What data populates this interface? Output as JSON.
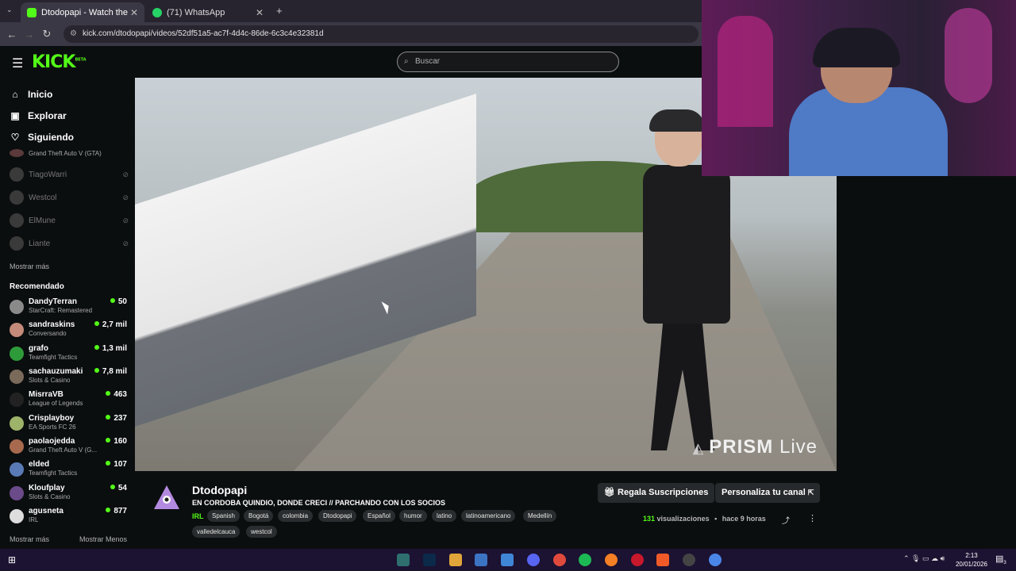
{
  "browser": {
    "tabs": [
      {
        "title": "Dtodopapi - Watch the VO",
        "active": true
      },
      {
        "title": "(71) WhatsApp",
        "active": false
      }
    ],
    "new_tab": "+",
    "url": "kick.com/dtodopapi/videos/52df51a5-ac7f-4d4c-86de-6c3c4e32381d"
  },
  "header": {
    "logo": "KICK",
    "logo_badge": "BETA",
    "search_placeholder": "Buscar"
  },
  "sidebar": {
    "nav": [
      {
        "label": "Inicio",
        "icon": "home-icon"
      },
      {
        "label": "Explorar",
        "icon": "compass-icon"
      },
      {
        "label": "Siguiendo",
        "icon": "heart-icon"
      }
    ],
    "following_partial_game": "Grand Theft Auto V (GTA)",
    "following": [
      "TiagoWarri",
      "Westcol",
      "ElMune",
      "Liante"
    ],
    "show_more": "Mostrar más",
    "recommended_title": "Recomendado",
    "recommended": [
      {
        "name": "DandyTerran",
        "game": "StarCraft: Remastered",
        "viewers": "50"
      },
      {
        "name": "sandraskins",
        "game": "Conversando",
        "viewers": "2,7 mil"
      },
      {
        "name": "grafo",
        "game": "Teamfight Tactics",
        "viewers": "1,3 mil"
      },
      {
        "name": "sachauzumaki",
        "game": "Slots & Casino",
        "viewers": "7,8 mil"
      },
      {
        "name": "MisrraVB",
        "game": "League of Legends",
        "viewers": "463"
      },
      {
        "name": "Crisplayboy",
        "game": "EA Sports FC 26",
        "viewers": "237"
      },
      {
        "name": "paolaojedda",
        "game": "Grand Theft Auto V (G...",
        "viewers": "160"
      },
      {
        "name": "elded",
        "game": "Teamfight Tactics",
        "viewers": "107"
      },
      {
        "name": "Kloufplay",
        "game": "Slots & Casino",
        "viewers": "54"
      },
      {
        "name": "agusneta",
        "game": "IRL",
        "viewers": "877"
      }
    ],
    "show_more_2": "Mostrar más",
    "show_less": "Mostrar Menos"
  },
  "video": {
    "watermark_bold": "PRISM",
    "watermark_light": "Live"
  },
  "channel": {
    "name": "Dtodopapi",
    "title": "EN CORDOBA QUINDIO, DONDE CRECI // PARCHANDO CON LOS SOCIOS",
    "category": "IRL",
    "tags": [
      "Spanish",
      "Bogotá",
      "colombia",
      "Dtodopapi",
      "Español",
      "humor",
      "latino",
      "latinoamericano",
      "Medellín",
      "valledelcauca",
      "westcol"
    ],
    "gift_button": "Regala Suscripciones",
    "customize_button": "Personaliza tu canal",
    "views_count": "131",
    "views_label": "visualizaciones",
    "time_ago": "hace 9 horas"
  },
  "taskbar": {
    "time": "2:13",
    "date": "20/01/2026",
    "notifications": "3"
  },
  "colors": {
    "accent": "#53fc18",
    "background": "#0b0e0f",
    "taskbar": "#1c1232"
  }
}
